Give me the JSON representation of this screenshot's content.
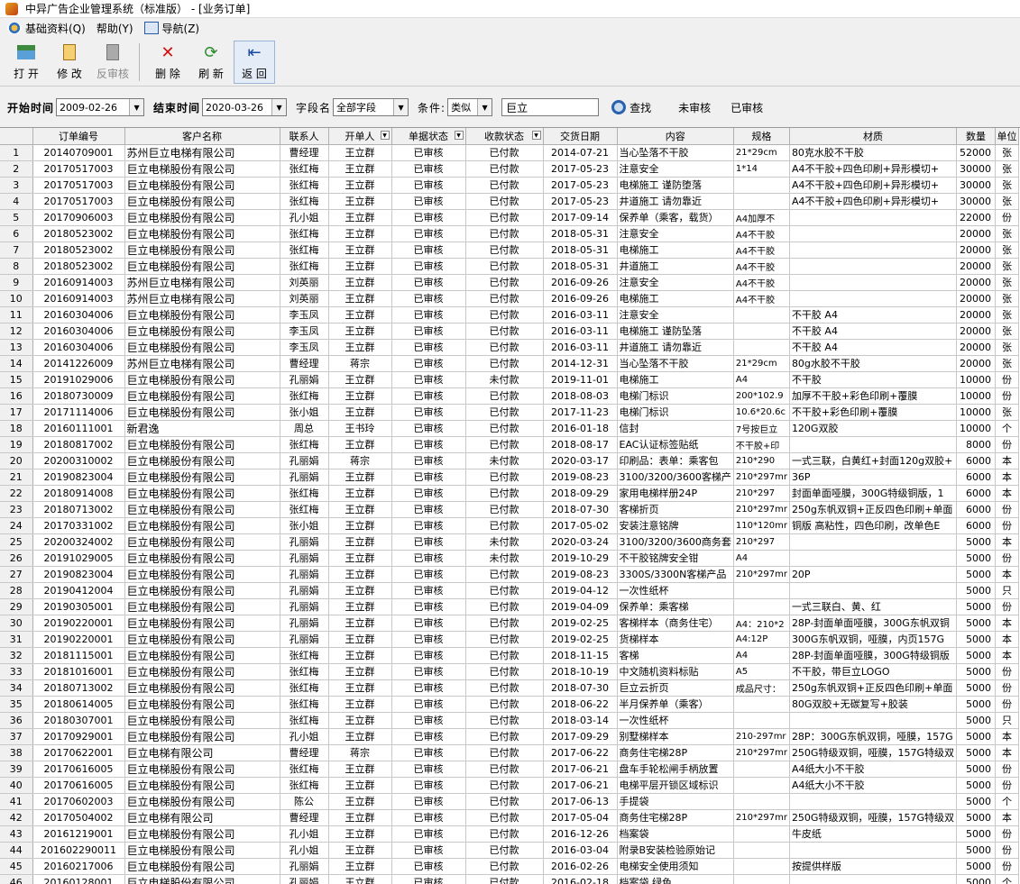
{
  "window": {
    "title": "中异广告企业管理系统（标准版） - [业务订单]"
  },
  "menu": {
    "items": [
      "基础资料(Q)",
      "帮助(Y)",
      "导航(Z)"
    ]
  },
  "toolbar": {
    "open": "打 开",
    "edit": "修 改",
    "unaudit": "反审核",
    "delete": "删 除",
    "refresh": "刷 新",
    "back": "返 回"
  },
  "filter": {
    "start_label": "开始时间",
    "start_value": "2009-02-26",
    "end_label": "结束时间",
    "end_value": "2020-03-26",
    "field_label": "字段名",
    "field_value": "全部字段",
    "cond_label": "条件:",
    "cond_value": "类似",
    "keyword": "巨立",
    "search_label": "查找",
    "unaudited_label": "未审核",
    "audited_label": "已审核"
  },
  "grid": {
    "columns": [
      "",
      "订单编号",
      "客户名称",
      "联系人",
      "开单人",
      "单据状态",
      "收款状态",
      "交货日期",
      "内容",
      "规格",
      "材质",
      "数量",
      "单位"
    ],
    "rows": [
      [
        "1",
        "20140709001",
        "苏州巨立电梯有限公司",
        "曹经理",
        "王立群",
        "已审核",
        "已付款",
        "2014-07-21",
        "当心坠落不干胶",
        "21*29cm",
        "80克水胶不干胶",
        "52000",
        "张"
      ],
      [
        "2",
        "20170517003",
        "巨立电梯股份有限公司",
        "张红梅",
        "王立群",
        "已审核",
        "已付款",
        "2017-05-23",
        "注意安全",
        "1*14",
        "A4不干胶+四色印刷+异形模切+",
        "30000",
        "张"
      ],
      [
        "3",
        "20170517003",
        "巨立电梯股份有限公司",
        "张红梅",
        "王立群",
        "已审核",
        "已付款",
        "2017-05-23",
        "电梯施工 谨防堕落",
        "",
        "A4不干胶+四色印刷+异形模切+",
        "30000",
        "张"
      ],
      [
        "4",
        "20170517003",
        "巨立电梯股份有限公司",
        "张红梅",
        "王立群",
        "已审核",
        "已付款",
        "2017-05-23",
        "井道施工 请勿靠近",
        "",
        "A4不干胶+四色印刷+异形模切+",
        "30000",
        "张"
      ],
      [
        "5",
        "20170906003",
        "巨立电梯股份有限公司",
        "孔小姐",
        "王立群",
        "已审核",
        "已付款",
        "2017-09-14",
        "保养单（乘客，载货）",
        "A4加厚不",
        "",
        "22000",
        "份"
      ],
      [
        "6",
        "20180523002",
        "巨立电梯股份有限公司",
        "张红梅",
        "王立群",
        "已审核",
        "已付款",
        "2018-05-31",
        "注意安全",
        "A4不干胶",
        "",
        "20000",
        "张"
      ],
      [
        "7",
        "20180523002",
        "巨立电梯股份有限公司",
        "张红梅",
        "王立群",
        "已审核",
        "已付款",
        "2018-05-31",
        "电梯施工",
        "A4不干胶",
        "",
        "20000",
        "张"
      ],
      [
        "8",
        "20180523002",
        "巨立电梯股份有限公司",
        "张红梅",
        "王立群",
        "已审核",
        "已付款",
        "2018-05-31",
        "井道施工",
        "A4不干胶",
        "",
        "20000",
        "张"
      ],
      [
        "9",
        "20160914003",
        "苏州巨立电梯有限公司",
        "刘英丽",
        "王立群",
        "已审核",
        "已付款",
        "2016-09-26",
        "注意安全",
        "A4不干胶",
        "",
        "20000",
        "张"
      ],
      [
        "10",
        "20160914003",
        "苏州巨立电梯有限公司",
        "刘英丽",
        "王立群",
        "已审核",
        "已付款",
        "2016-09-26",
        "电梯施工",
        "A4不干胶",
        "",
        "20000",
        "张"
      ],
      [
        "11",
        "20160304006",
        "巨立电梯股份有限公司",
        "李玉凤",
        "王立群",
        "已审核",
        "已付款",
        "2016-03-11",
        "注意安全",
        "",
        "不干胶 A4",
        "20000",
        "张"
      ],
      [
        "12",
        "20160304006",
        "巨立电梯股份有限公司",
        "李玉凤",
        "王立群",
        "已审核",
        "已付款",
        "2016-03-11",
        "电梯施工 谨防坠落",
        "",
        "不干胶 A4",
        "20000",
        "张"
      ],
      [
        "13",
        "20160304006",
        "巨立电梯股份有限公司",
        "李玉凤",
        "王立群",
        "已审核",
        "已付款",
        "2016-03-11",
        "井道施工 请勿靠近",
        "",
        "不干胶 A4",
        "20000",
        "张"
      ],
      [
        "14",
        "20141226009",
        "苏州巨立电梯有限公司",
        "曹经理",
        "蒋宗",
        "已审核",
        "已付款",
        "2014-12-31",
        "当心坠落不干胶",
        "21*29cm",
        "80g水胶不干胶",
        "20000",
        "张"
      ],
      [
        "15",
        "20191029006",
        "巨立电梯股份有限公司",
        "孔丽娟",
        "王立群",
        "已审核",
        "未付款",
        "2019-11-01",
        "电梯施工",
        "A4",
        "不干胶",
        "10000",
        "份"
      ],
      [
        "16",
        "20180730009",
        "巨立电梯股份有限公司",
        "张红梅",
        "王立群",
        "已审核",
        "已付款",
        "2018-08-03",
        "电梯门标识",
        "200*102.9",
        "加厚不干胶+彩色印刷+覆膜",
        "10000",
        "份"
      ],
      [
        "17",
        "20171114006",
        "巨立电梯股份有限公司",
        "张小姐",
        "王立群",
        "已审核",
        "已付款",
        "2017-11-23",
        "电梯门标识",
        "10.6*20.6c",
        "不干胶+彩色印刷+覆膜",
        "10000",
        "张"
      ],
      [
        "18",
        "20160111001",
        "新君逸",
        "周总",
        "王书玲",
        "已审核",
        "已付款",
        "2016-01-18",
        "信封",
        "7号按巨立",
        "120G双胶",
        "10000",
        "个"
      ],
      [
        "19",
        "20180817002",
        "巨立电梯股份有限公司",
        "张红梅",
        "王立群",
        "已审核",
        "已付款",
        "2018-08-17",
        "EAC认证标签贴纸",
        "不干胶+印",
        "",
        "8000",
        "份"
      ],
      [
        "20",
        "20200310002",
        "巨立电梯股份有限公司",
        "孔丽娟",
        "蒋宗",
        "已审核",
        "未付款",
        "2020-03-17",
        "印刷品：表单：乘客包",
        "210*290",
        "一式三联，白黄红+封面120g双胶+",
        "6000",
        "本"
      ],
      [
        "21",
        "20190823004",
        "巨立电梯股份有限公司",
        "孔丽娟",
        "王立群",
        "已审核",
        "已付款",
        "2019-08-23",
        "3100/3200/3600客梯产",
        "210*297mr",
        "36P",
        "6000",
        "本"
      ],
      [
        "22",
        "20180914008",
        "巨立电梯股份有限公司",
        "张红梅",
        "王立群",
        "已审核",
        "已付款",
        "2018-09-29",
        "家用电梯样册24P",
        "210*297",
        "封面单面哑膜，300G特级铜版，1",
        "6000",
        "本"
      ],
      [
        "23",
        "20180713002",
        "巨立电梯股份有限公司",
        "张红梅",
        "王立群",
        "已审核",
        "已付款",
        "2018-07-30",
        "客梯折页",
        "210*297mr",
        "250g东帆双铜+正反四色印刷+单面",
        "6000",
        "份"
      ],
      [
        "24",
        "20170331002",
        "巨立电梯股份有限公司",
        "张小姐",
        "王立群",
        "已审核",
        "已付款",
        "2017-05-02",
        "安装注意铭牌",
        "110*120mr",
        "铜版 高粘性，四色印刷，改单色E",
        "6000",
        "份"
      ],
      [
        "25",
        "20200324002",
        "巨立电梯股份有限公司",
        "孔丽娟",
        "王立群",
        "已审核",
        "未付款",
        "2020-03-24",
        "3100/3200/3600商务套",
        "210*297",
        "",
        "5000",
        "本"
      ],
      [
        "26",
        "20191029005",
        "巨立电梯股份有限公司",
        "孔丽娟",
        "王立群",
        "已审核",
        "未付款",
        "2019-10-29",
        "不干胶铭牌安全钳",
        "A4",
        "",
        "5000",
        "份"
      ],
      [
        "27",
        "20190823004",
        "巨立电梯股份有限公司",
        "孔丽娟",
        "王立群",
        "已审核",
        "已付款",
        "2019-08-23",
        "3300S/3300N客梯产品",
        "210*297mr",
        "20P",
        "5000",
        "本"
      ],
      [
        "28",
        "20190412004",
        "巨立电梯股份有限公司",
        "孔丽娟",
        "王立群",
        "已审核",
        "已付款",
        "2019-04-12",
        "一次性纸杯",
        "",
        "",
        "5000",
        "只"
      ],
      [
        "29",
        "20190305001",
        "巨立电梯股份有限公司",
        "孔丽娟",
        "王立群",
        "已审核",
        "已付款",
        "2019-04-09",
        "保养单：乘客梯",
        "",
        "一式三联白、黄、红",
        "5000",
        "份"
      ],
      [
        "30",
        "20190220001",
        "巨立电梯股份有限公司",
        "孔丽娟",
        "王立群",
        "已审核",
        "已付款",
        "2019-02-25",
        "客梯样本（商务住宅）",
        "A4：210*2",
        "28P-封面单面哑膜，300G东帆双铜",
        "5000",
        "本"
      ],
      [
        "31",
        "20190220001",
        "巨立电梯股份有限公司",
        "孔丽娟",
        "王立群",
        "已审核",
        "已付款",
        "2019-02-25",
        "货梯样本",
        "A4:12P",
        "300G东帆双铜，哑膜，内页157G",
        "5000",
        "本"
      ],
      [
        "32",
        "20181115001",
        "巨立电梯股份有限公司",
        "张红梅",
        "王立群",
        "已审核",
        "已付款",
        "2018-11-15",
        "客梯",
        "A4",
        "28P-封面单面哑膜，300G特级铜版",
        "5000",
        "本"
      ],
      [
        "33",
        "20181016001",
        "巨立电梯股份有限公司",
        "张红梅",
        "王立群",
        "已审核",
        "已付款",
        "2018-10-19",
        "中文随机资料标贴",
        "A5",
        "不干胶，带巨立LOGO",
        "5000",
        "份"
      ],
      [
        "34",
        "20180713002",
        "巨立电梯股份有限公司",
        "张红梅",
        "王立群",
        "已审核",
        "已付款",
        "2018-07-30",
        "巨立云折页",
        "成品尺寸：",
        "250g东帆双铜+正反四色印刷+单面",
        "5000",
        "份"
      ],
      [
        "35",
        "20180614005",
        "巨立电梯股份有限公司",
        "张红梅",
        "王立群",
        "已审核",
        "已付款",
        "2018-06-22",
        "半月保养单（乘客）",
        "",
        "80G双胶+无碳复写+胶装",
        "5000",
        "份"
      ],
      [
        "36",
        "20180307001",
        "巨立电梯股份有限公司",
        "张红梅",
        "王立群",
        "已审核",
        "已付款",
        "2018-03-14",
        "一次性纸杯",
        "",
        "",
        "5000",
        "只"
      ],
      [
        "37",
        "20170929001",
        "巨立电梯股份有限公司",
        "孔小姐",
        "王立群",
        "已审核",
        "已付款",
        "2017-09-29",
        "别墅梯样本",
        "210-297mr",
        "28P：300G东帆双铜，哑膜，157G",
        "5000",
        "本"
      ],
      [
        "38",
        "20170622001",
        "巨立电梯有限公司",
        "曹经理",
        "蒋宗",
        "已审核",
        "已付款",
        "2017-06-22",
        "商务住宅梯28P",
        "210*297mr",
        "250G特级双铜，哑膜，157G特级双",
        "5000",
        "本"
      ],
      [
        "39",
        "20170616005",
        "巨立电梯股份有限公司",
        "张红梅",
        "王立群",
        "已审核",
        "已付款",
        "2017-06-21",
        "盘车手轮松闸手柄放置",
        "",
        "A4纸大小不干胶",
        "5000",
        "份"
      ],
      [
        "40",
        "20170616005",
        "巨立电梯股份有限公司",
        "张红梅",
        "王立群",
        "已审核",
        "已付款",
        "2017-06-21",
        "电梯平层开锁区域标识",
        "",
        "A4纸大小不干胶",
        "5000",
        "份"
      ],
      [
        "41",
        "20170602003",
        "巨立电梯股份有限公司",
        "陈公",
        "王立群",
        "已审核",
        "已付款",
        "2017-06-13",
        "手提袋",
        "",
        "",
        "5000",
        "个"
      ],
      [
        "42",
        "20170504002",
        "巨立电梯有限公司",
        "曹经理",
        "王立群",
        "已审核",
        "已付款",
        "2017-05-04",
        "商务住宅梯28P",
        "210*297mr",
        "250G特级双铜，哑膜，157G特级双",
        "5000",
        "本"
      ],
      [
        "43",
        "20161219001",
        "巨立电梯股份有限公司",
        "孔小姐",
        "王立群",
        "已审核",
        "已付款",
        "2016-12-26",
        "档案袋",
        "",
        "牛皮纸",
        "5000",
        "份"
      ],
      [
        "44",
        "201602290011",
        "巨立电梯股份有限公司",
        "孔小姐",
        "王立群",
        "已审核",
        "已付款",
        "2016-03-04",
        "附录B安装检验原始记",
        "",
        "",
        "5000",
        "份"
      ],
      [
        "45",
        "20160217006",
        "巨立电梯股份有限公司",
        "孔丽娟",
        "王立群",
        "已审核",
        "已付款",
        "2016-02-26",
        "电梯安全使用须知",
        "",
        "按提供样版",
        "5000",
        "份"
      ],
      [
        "46",
        "20160128001",
        "巨立电梯股份有限公司",
        "孔丽娟",
        "王立群",
        "已审核",
        "已付款",
        "2016-02-18",
        "档案袋 绿色",
        "",
        "",
        "5000",
        "个"
      ]
    ]
  }
}
